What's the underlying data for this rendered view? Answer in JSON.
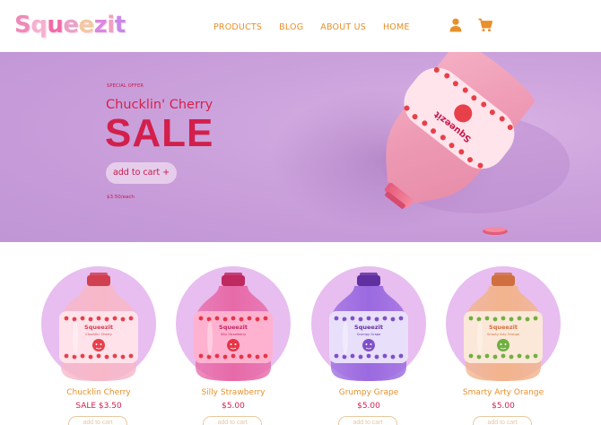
{
  "brand": {
    "name": "Squeezit",
    "letter_colors": [
      "#f08ab8",
      "#f5b0d0",
      "#f26aa8",
      "#e8a0c8",
      "#f2c8a0",
      "#d888e0",
      "#f0a0c0",
      "#c888e8"
    ]
  },
  "nav": {
    "items": [
      "PRODUCTS",
      "BLOG",
      "ABOUT US",
      "HOME"
    ],
    "color": "#e8902a"
  },
  "header_icons": [
    "user-icon",
    "shopping-cart-icon"
  ],
  "hero": {
    "eyebrow": "SPECIAL OFFER",
    "product_name": "Chucklin' Cherry",
    "headline": "SALE",
    "cta_label": "add to cart +",
    "unit_price": "$3.50/each",
    "bottle_label_brand": "Squeezit",
    "background": "#c69ad8",
    "accent": "#d31f4c"
  },
  "products": [
    {
      "name": "Chucklin Cherry",
      "price": "SALE $3.50",
      "label_brand": "Squeezit",
      "label_flavor": "Chucklin' Cherry",
      "liquid": "#f7b8c8",
      "label": "#ffe2ea",
      "fruit": "#e8404a",
      "cap": "#d04050"
    },
    {
      "name": "Silly Strawberry",
      "price": "$5.00",
      "label_brand": "Squeezit",
      "label_flavor": "Silly Strawberry",
      "liquid": "#e76aa8",
      "label": "#ffb2d0",
      "fruit": "#e83448",
      "cap": "#c02860"
    },
    {
      "name": "Grumpy Grape",
      "price": "$5.00",
      "label_brand": "Squeezit",
      "label_flavor": "Grumpy Grape",
      "liquid": "#9a6ae0",
      "label": "#e8e0fa",
      "fruit": "#8050c8",
      "cap": "#6030a0"
    },
    {
      "name": "Smarty Arty Orange",
      "price": "$5.00",
      "label_brand": "Squeezit",
      "label_flavor": "Smarty Arty Orange",
      "liquid": "#f2b48c",
      "label": "#fbe8d8",
      "fruit": "#70b040",
      "cap": "#d07040"
    }
  ],
  "product_button_label": "add to cart"
}
